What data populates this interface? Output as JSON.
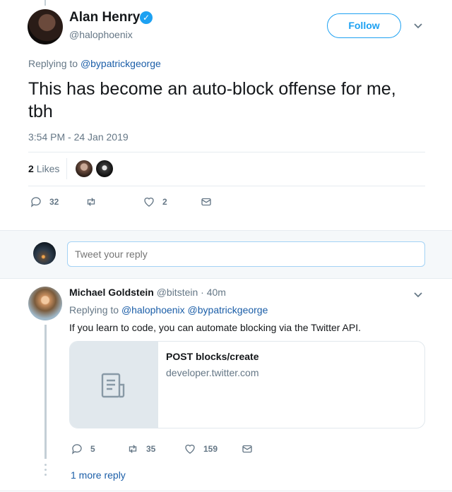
{
  "tweet": {
    "author_name": "Alan Henry",
    "author_handle": "@halophoenix",
    "follow_label": "Follow",
    "replying_prefix": "Replying to",
    "replying_handle": "@bypatrickgeorge",
    "text": "This has become an auto-block offense for me, tbh",
    "timestamp": "3:54 PM - 24 Jan 2019",
    "likes_count": "2",
    "likes_label": "Likes",
    "actions": {
      "reply_count": "32",
      "retweet_count": "",
      "like_count": "2"
    }
  },
  "compose": {
    "placeholder": "Tweet your reply"
  },
  "reply": {
    "author_name": "Michael Goldstein",
    "author_handle": "@bitstein",
    "time_ago": "· 40m",
    "replying_prefix": "Replying to",
    "replying_handles": "@halophoenix @bypatrickgeorge",
    "text": "If you learn to code, you can automate blocking via the Twitter API.",
    "card": {
      "title": "POST blocks/create",
      "domain": "developer.twitter.com"
    },
    "actions": {
      "reply_count": "5",
      "retweet_count": "35",
      "like_count": "159"
    },
    "more_replies": "1 more reply"
  },
  "colors": {
    "accent": "#1da1f2",
    "link": "#1b5ea8",
    "muted": "#657786"
  }
}
